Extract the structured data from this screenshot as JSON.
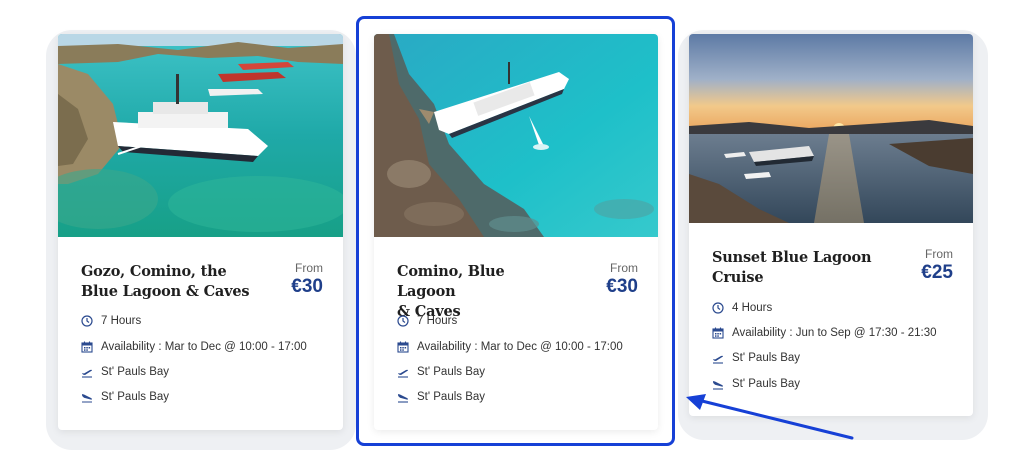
{
  "cards": [
    {
      "title_line1": "Gozo, Comino, the",
      "title_line2": "Blue Lagoon & Caves",
      "from_label": "From",
      "price": "€30",
      "duration": "7 Hours",
      "availability": "Availability : Mar to Dec @ 10:00 - 17:00",
      "departure": "St' Pauls Bay",
      "arrival": "St' Pauls Bay"
    },
    {
      "title_line1": "Comino, Blue Lagoon",
      "title_line2": "& Caves",
      "from_label": "From",
      "price": "€30",
      "duration": "7 Hours",
      "availability": "Availability : Mar to Dec @ 10:00 - 17:00",
      "departure": "St' Pauls Bay",
      "arrival": "St' Pauls Bay"
    },
    {
      "title_line1": "Sunset Blue Lagoon",
      "title_line2": "Cruise",
      "from_label": "From",
      "price": "€25",
      "duration": "4 Hours",
      "availability": "Availability : Jun to Sep @ 17:30 - 21:30",
      "departure": "St' Pauls Bay",
      "arrival": "St' Pauls Bay"
    }
  ],
  "colors": {
    "price": "#1f3f8a",
    "highlight": "#1640d6",
    "icon": "#2b4a8f"
  },
  "icons": [
    "clock-icon",
    "calendar-icon",
    "plane-departure-icon",
    "plane-arrival-icon"
  ]
}
